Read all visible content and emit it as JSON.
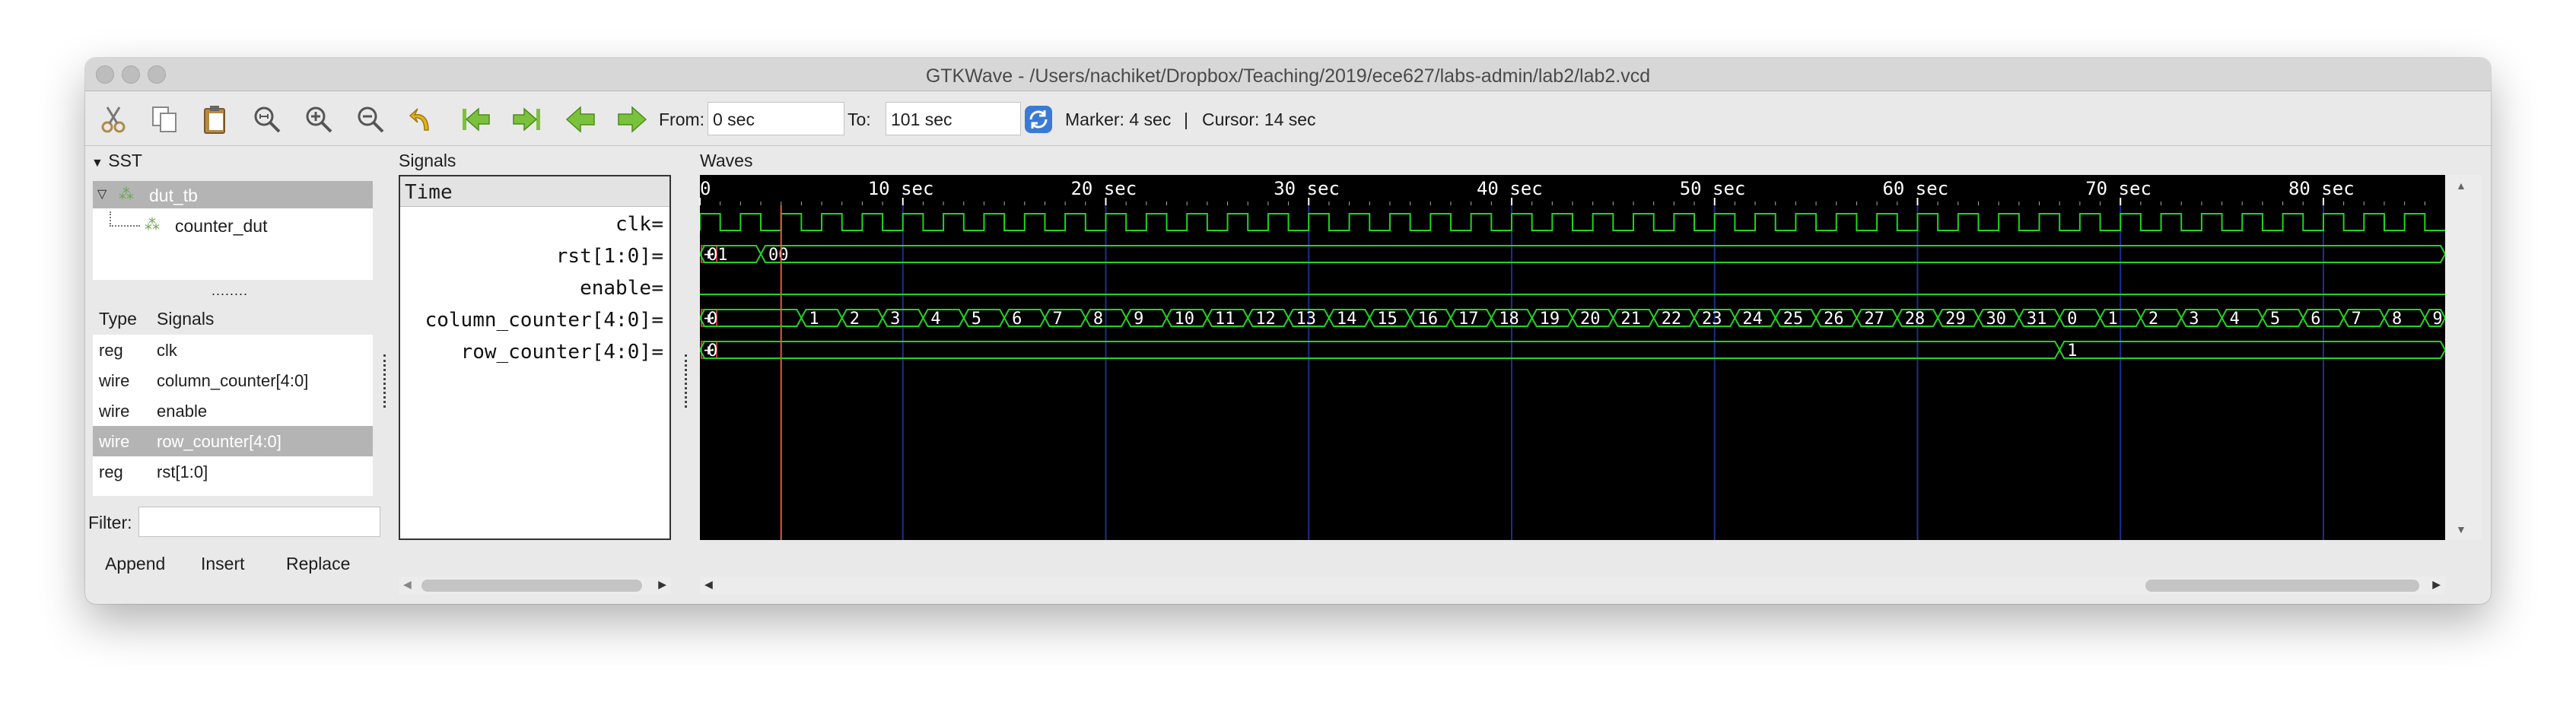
{
  "window": {
    "title": "GTKWave - /Users/nachiket/Dropbox/Teaching/2019/ece627/labs-admin/lab2/lab2.vcd"
  },
  "toolbar": {
    "icons": [
      "cut-icon",
      "copy-icon",
      "paste-icon",
      "zoom-fit-icon",
      "zoom-in-icon",
      "zoom-out-icon",
      "undo-icon",
      "jump-start-icon",
      "jump-end-icon",
      "prev-edge-icon",
      "next-edge-icon",
      "reload-icon"
    ],
    "from_label": "From:",
    "from_value": "0 sec",
    "to_label": "To:",
    "to_value": "101 sec",
    "marker": "Marker: 4 sec",
    "separator": "|",
    "cursor": "Cursor: 14 sec"
  },
  "sst": {
    "header": "SST",
    "tree": [
      {
        "label": "dut_tb",
        "selected": true
      },
      {
        "label": "counter_dut",
        "selected": false
      }
    ],
    "list_headers": {
      "type": "Type",
      "signals": "Signals"
    },
    "signals": [
      {
        "type": "reg",
        "name": "clk",
        "selected": false
      },
      {
        "type": "wire",
        "name": "column_counter[4:0]",
        "selected": false
      },
      {
        "type": "wire",
        "name": "enable",
        "selected": false
      },
      {
        "type": "wire",
        "name": "row_counter[4:0]",
        "selected": true
      },
      {
        "type": "reg",
        "name": "rst[1:0]",
        "selected": false
      }
    ],
    "filter_label": "Filter:",
    "filter_value": "",
    "buttons": {
      "append": "Append",
      "insert": "Insert",
      "replace": "Replace"
    }
  },
  "signals_pane": {
    "header": "Signals",
    "time_label": "Time",
    "rows": [
      "clk",
      "rst[1:0]",
      "enable",
      "column_counter[4:0]",
      "row_counter[4:0]"
    ],
    "suffix": "="
  },
  "waves": {
    "header": "Waves",
    "time_labels": [
      "0",
      "10 sec",
      "20 sec",
      "30 sec",
      "40 sec",
      "50 sec",
      "60 sec",
      "70 sec",
      "80 sec"
    ],
    "time_label_values": [
      0,
      10,
      20,
      30,
      40,
      50,
      60,
      70,
      80
    ],
    "view_start": 0,
    "view_end": 86,
    "marker_time": 4,
    "rst": {
      "segments": [
        {
          "start": 0,
          "end": 3,
          "value": "01"
        },
        {
          "start": 3,
          "end": 86,
          "value": "00"
        }
      ]
    },
    "enable_level": 0,
    "column_counter": {
      "first_label": "0",
      "count_start_time": 5,
      "step": 2,
      "values": [
        "1",
        "2",
        "3",
        "4",
        "5",
        "6",
        "7",
        "8",
        "9",
        "10",
        "11",
        "12",
        "13",
        "14",
        "15",
        "16",
        "17",
        "18",
        "19",
        "20",
        "21",
        "22",
        "23",
        "24",
        "25",
        "26",
        "27",
        "28",
        "29",
        "30",
        "31",
        "0",
        "1",
        "2",
        "3",
        "4",
        "5",
        "6",
        "7",
        "8",
        "9"
      ]
    },
    "row_counter": {
      "segments": [
        {
          "start": 0,
          "end": 67,
          "value": "0"
        },
        {
          "start": 67,
          "end": 86,
          "value": "1"
        }
      ]
    },
    "expand_marker": "+"
  },
  "colors": {
    "wave": "#22d322",
    "grid": "#1d2f8a",
    "marker": "#e35a41",
    "background": "#000000",
    "text": "#ffffff"
  }
}
